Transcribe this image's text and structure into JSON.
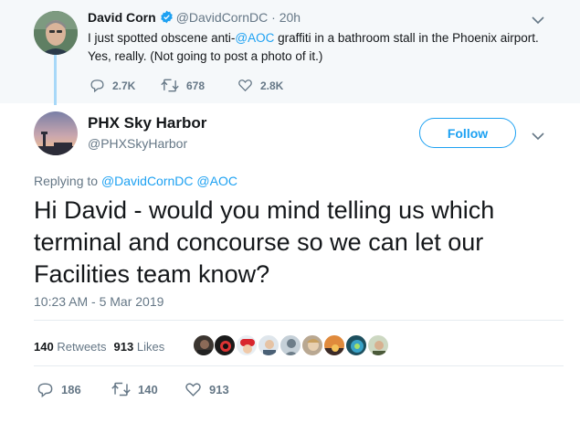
{
  "parent_tweet": {
    "name": "David Corn",
    "handle": "@DavidCornDC",
    "dot": "·",
    "time": "20h",
    "text_pre": "I just spotted obscene anti-",
    "mention": "@AOC",
    "text_post": " graffiti in a bathroom stall in the Phoenix airport. Yes, really. (Not going to post a photo of it.)",
    "replies": "2.7K",
    "retweets": "678",
    "likes": "2.8K"
  },
  "reply_tweet": {
    "name": "PHX Sky Harbor",
    "handle": "@PHXSkyHarbor",
    "follow_label": "Follow",
    "replying_to_label": "Replying to",
    "replying_to_1": "@DavidCornDC",
    "replying_to_2": "@AOC",
    "text": "Hi David - would you mind telling us which terminal and concourse so we can let our Facilities team know?",
    "timestamp": "10:23 AM - 5 Mar 2019",
    "retweets_count": "140",
    "retweets_label": "Retweets",
    "likes_count": "913",
    "likes_label": "Likes",
    "replies": "186",
    "retweets": "140",
    "likes": "913"
  },
  "icons": {
    "verified": "verified-badge-icon",
    "reply": "reply-icon",
    "retweet": "retweet-icon",
    "like": "heart-icon",
    "caret": "chevron-down-icon"
  },
  "colors": {
    "accent": "#1da1f2",
    "secondary_text": "#657786",
    "thread_line": "#a7d8f8",
    "parent_bg": "#f5f8fa"
  }
}
